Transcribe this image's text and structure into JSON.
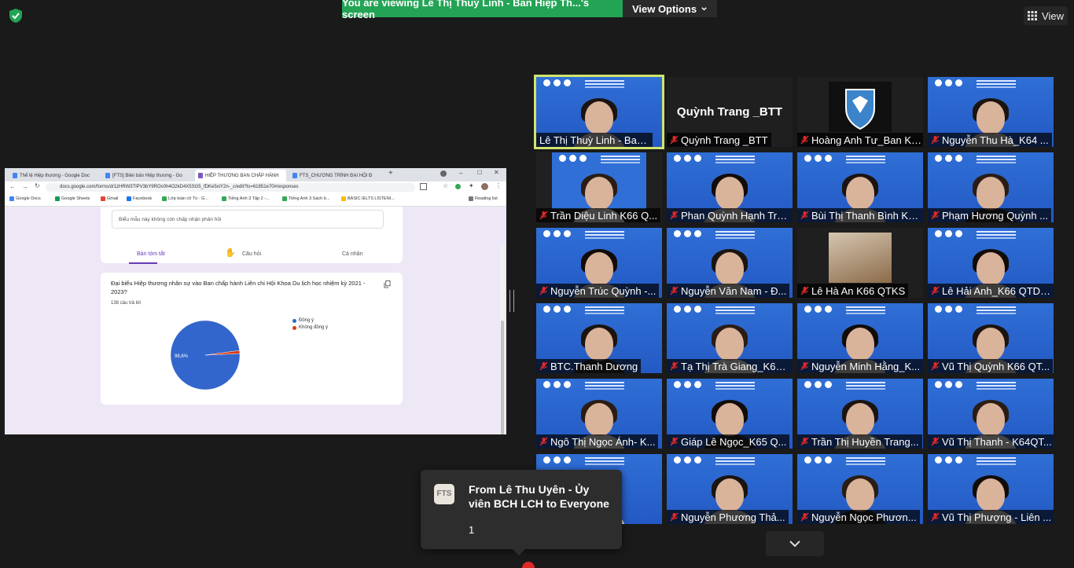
{
  "topbar": {
    "viewing_text": "You are viewing Lê Thị Thuỳ Linh - Ban Hiệp Th...'s screen",
    "view_options_label": "View Options",
    "view_label": "View"
  },
  "browser": {
    "tabs": [
      {
        "label": "Thể lệ Hiệp thương - Google Doc",
        "color": "#4285f4"
      },
      {
        "label": "[FTS] Biên bản Hiệp thương - Go",
        "color": "#4285f4"
      },
      {
        "label": "HIỆP THƯƠNG BAN CHẤP HÀNH",
        "color": "#7e57c2"
      },
      {
        "label": "FTS_CHƯƠNG TRÌNH ĐẠI HỘI Đ",
        "color": "#4285f4"
      }
    ],
    "url": "docs.google.com/forms/d/1zHRW3TlPV3bY9ROs0h4O2kD4X5SG5_fDKe5xiY2n-_c/edit?ts=61851e70#responses",
    "bookmarks": [
      {
        "label": "Google Docs",
        "color": "#4285f4"
      },
      {
        "label": "Google Sheets",
        "color": "#0f9d58"
      },
      {
        "label": "Gmail",
        "color": "#ea4335"
      },
      {
        "label": "Facebook",
        "color": "#1877f2"
      },
      {
        "label": "Lớp toán cô Tú - G...",
        "color": "#34a853"
      },
      {
        "label": "Tiếng Anh 3 Tập 2 -...",
        "color": "#34a853"
      },
      {
        "label": "Tiếng Anh 3 Sách b...",
        "color": "#34a853"
      },
      {
        "label": "BASIC IELTS LISTENI...",
        "color": "#fbbc04"
      }
    ],
    "reading_list": "Reading list"
  },
  "form": {
    "no_responses_notice": "Biểu mẫu này không còn chấp nhận phản hồi",
    "tabs": {
      "summary": "Bản tóm tắt",
      "question": "Câu hỏi",
      "individual": "Cá nhân"
    },
    "question_title": "Đại biểu Hiệp thương nhân sự vào Ban chấp hành Liên chi Hội Khoa Du lịch học nhiệm kỳ 2021 - 2023?",
    "response_count": "138 câu trả lời",
    "pie_label": "98,6%"
  },
  "chart_data": {
    "type": "pie",
    "categories": [
      "Đồng ý",
      "Không đồng ý"
    ],
    "values": [
      98.6,
      1.4
    ],
    "colors": [
      "#3366cc",
      "#dc3912"
    ]
  },
  "gallery": {
    "tiles": [
      {
        "name": "Lê Thị Thuỳ Linh - Ban Hi..."
      },
      {
        "name": "Quỳnh Trang _BTT",
        "bigname": "Quỳnh Trang _BTT"
      },
      {
        "name": "Hoàng Anh Tư_Ban Ki..."
      },
      {
        "name": "Nguyễn Thu Hà_K64 ..."
      },
      {
        "name": "Trần Diệu Linh K66 Q..."
      },
      {
        "name": "Phan Quỳnh Hạnh Tra..."
      },
      {
        "name": "Bùi Thị Thanh Bình K6..."
      },
      {
        "name": "Phạm Hương Quỳnh ..."
      },
      {
        "name": "Nguyễn Trúc Quỳnh -..."
      },
      {
        "name": "Nguyễn Văn Nam - Đ..."
      },
      {
        "name": "Lê Hà An K66 QTKS"
      },
      {
        "name": "Lê Hải Anh_K66 QTDV..."
      },
      {
        "name": "BTC.Thanh Dương"
      },
      {
        "name": "Tạ Thị Trà Giang_K65 ..."
      },
      {
        "name": "Nguyễn Minh Hằng_K..."
      },
      {
        "name": "Vũ Thị Quỳnh K66 QT..."
      },
      {
        "name": "Ngô Thị Ngọc Ánh- K..."
      },
      {
        "name": "Giáp Lê Ngọc_K65 Q..."
      },
      {
        "name": "Trần Thị Huyền Trang..."
      },
      {
        "name": "Vũ Thị Thanh - K64QT..."
      },
      {
        "name": "ng Trà..."
      },
      {
        "name": "Nguyễn Phương Thả..."
      },
      {
        "name": "Nguyễn Ngọc Phươn..."
      },
      {
        "name": "Vũ Thị Phượng - Liên ..."
      }
    ]
  },
  "chat_popup": {
    "avatar_text": "FTS",
    "from": "From Lê Thu Uyên - Ủy viên BCH LCH to Everyone",
    "message": "1"
  },
  "colors": {
    "banner_green": "#23a455",
    "active_speaker_outline": "#d2e36d",
    "muted_red": "#e02828"
  }
}
